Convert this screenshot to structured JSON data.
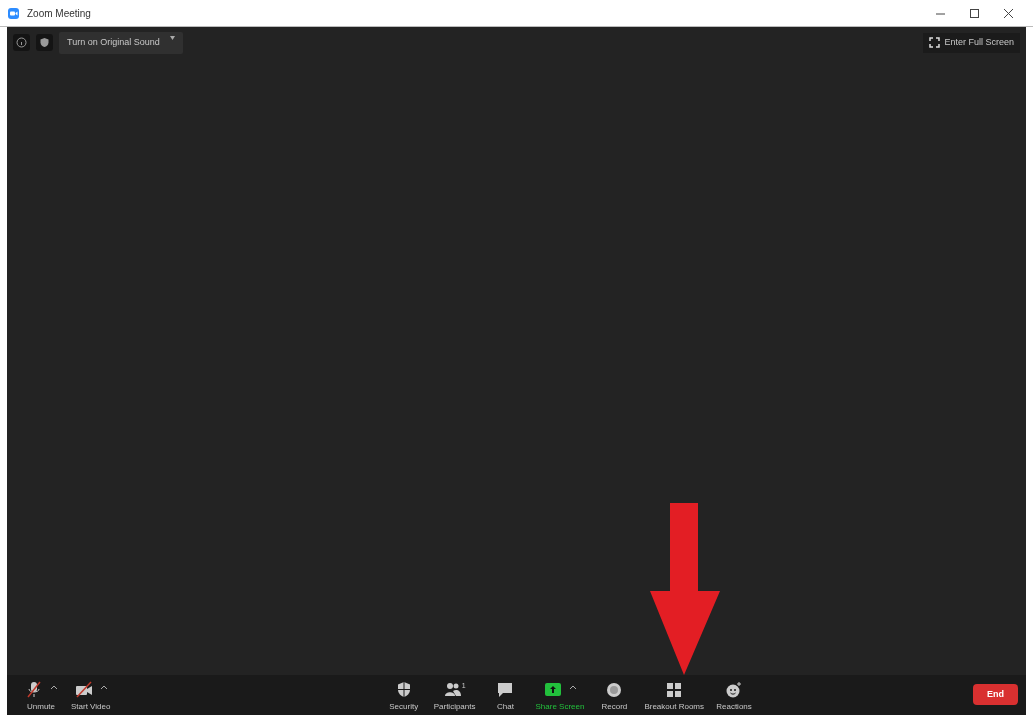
{
  "window": {
    "title": "Zoom Meeting"
  },
  "top_bar": {
    "sound_button": "Turn on Original Sound",
    "fullscreen_button": "Enter Full Screen"
  },
  "toolbar": {
    "left": [
      {
        "kind": "mic",
        "label": "Unmute",
        "caret": true,
        "highlighted": false
      },
      {
        "kind": "video",
        "label": "Start Video",
        "caret": true,
        "highlighted": false
      }
    ],
    "center": [
      {
        "kind": "security",
        "label": "Security",
        "caret": false,
        "highlighted": false
      },
      {
        "kind": "participants",
        "label": "Participants",
        "count": "1",
        "caret": false,
        "highlighted": false
      },
      {
        "kind": "chat",
        "label": "Chat",
        "caret": false,
        "highlighted": false
      },
      {
        "kind": "share",
        "label": "Share Screen",
        "caret": true,
        "highlighted": true
      },
      {
        "kind": "record",
        "label": "Record",
        "caret": false,
        "highlighted": false
      },
      {
        "kind": "breakout",
        "label": "Breakout Rooms",
        "caret": false,
        "highlighted": false
      },
      {
        "kind": "reactions",
        "label": "Reactions",
        "caret": false,
        "highlighted": false
      }
    ],
    "end_button": "End"
  },
  "annotations": [
    {
      "kind": "arrow"
    }
  ]
}
